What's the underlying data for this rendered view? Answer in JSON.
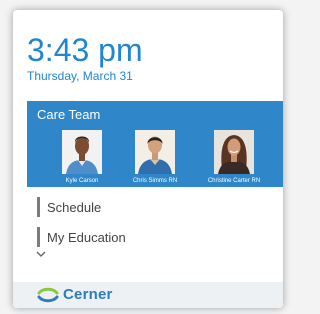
{
  "clock": {
    "time": "3:43 pm",
    "date": "Thursday, March 31"
  },
  "care_team": {
    "title": "Care Team",
    "members": [
      {
        "name": "Kyle Carson"
      },
      {
        "name": "Chris Simms RN"
      },
      {
        "name": "Christine Carter RN"
      }
    ]
  },
  "menu": {
    "items": [
      {
        "label": "Schedule"
      },
      {
        "label": "My Education"
      }
    ]
  },
  "footer": {
    "brand": "Cerner"
  },
  "colors": {
    "accent": "#1f86cf",
    "care_team_bg": "#2f86c9",
    "brand_green": "#8cc63f",
    "brand_blue": "#2c7dbf"
  },
  "icons": {
    "expand": "chevron-down-icon",
    "logo": "cerner-logo-icon"
  }
}
